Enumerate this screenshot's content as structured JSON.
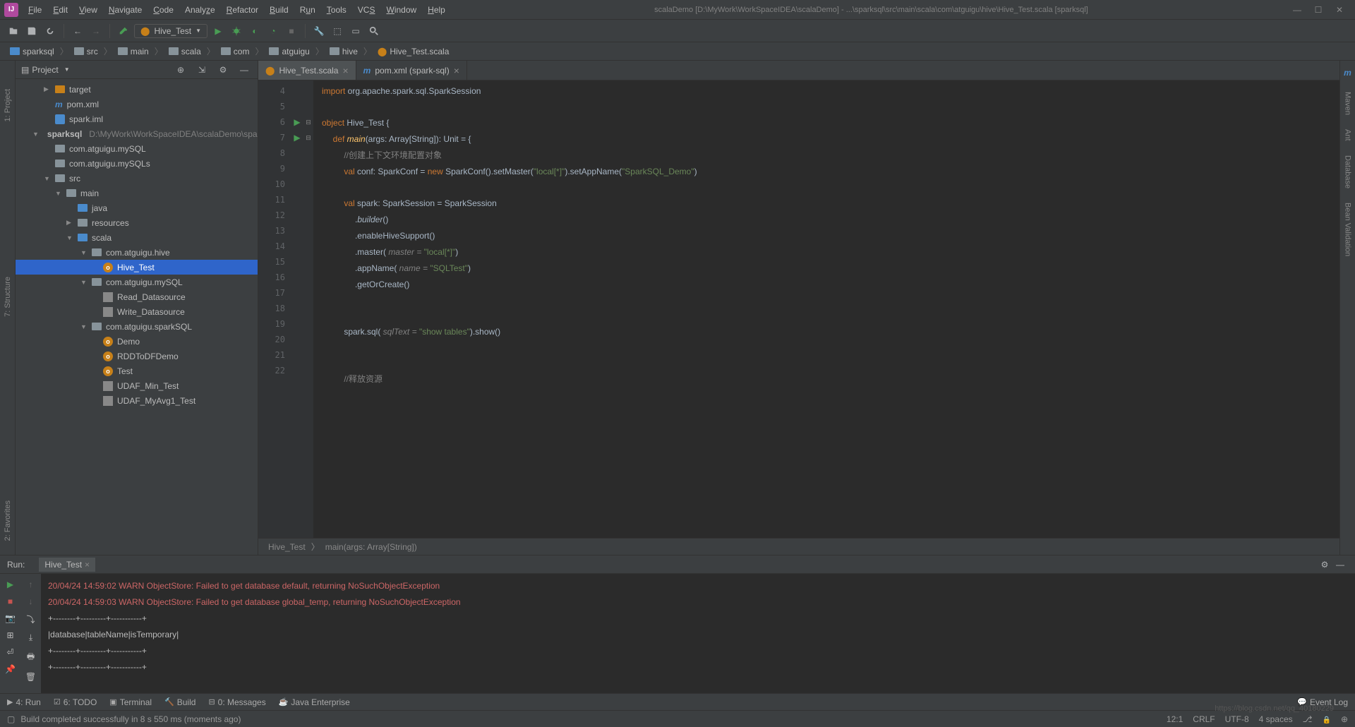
{
  "menu": {
    "items": [
      "File",
      "Edit",
      "View",
      "Navigate",
      "Code",
      "Analyze",
      "Refactor",
      "Build",
      "Run",
      "Tools",
      "VCS",
      "Window",
      "Help"
    ]
  },
  "title": "scalaDemo [D:\\MyWork\\WorkSpaceIDEA\\scalaDemo] - ...\\sparksql\\src\\main\\scala\\com\\atguigu\\hive\\Hive_Test.scala [sparksql]",
  "run_config": "Hive_Test",
  "breadcrumbs": [
    "sparksql",
    "src",
    "main",
    "scala",
    "com",
    "atguigu",
    "hive",
    "Hive_Test.scala"
  ],
  "project_panel": {
    "title": "Project"
  },
  "tree": {
    "target": "target",
    "pom": "pom.xml",
    "sparkiml": "spark.iml",
    "sparksql": "sparksql",
    "sparksql_path": "D:\\MyWork\\WorkSpaceIDEA\\scalaDemo\\spa",
    "pkg_mysql": "com.atguigu.mySQL",
    "pkg_mysqls": "com.atguigu.mySQLs",
    "src": "src",
    "main": "main",
    "java": "java",
    "resources": "resources",
    "scala": "scala",
    "pkg_hive": "com.atguigu.hive",
    "hive_test": "Hive_Test",
    "pkg_mysql2": "com.atguigu.mySQL",
    "read_ds": "Read_Datasource",
    "write_ds": "Write_Datasource",
    "pkg_sparksql": "com.atguigu.sparkSQL",
    "demo": "Demo",
    "rdd": "RDDToDFDemo",
    "test": "Test",
    "udaf_min": "UDAF_Min_Test",
    "udaf_avg": "UDAF_MyAvg1_Test"
  },
  "tabs": {
    "t1": "Hive_Test.scala",
    "t2": "pom.xml (spark-sql)"
  },
  "code": {
    "lines": [
      4,
      5,
      6,
      7,
      8,
      9,
      10,
      11,
      12,
      13,
      14,
      15,
      16,
      17,
      18,
      19,
      20,
      21,
      22
    ],
    "l4_a": "import",
    "l4_b": " org.apache.spark.sql.SparkSession",
    "l6_a": "object",
    "l6_b": " Hive_Test {",
    "l7_a": "def ",
    "l7_b": "main",
    "l7_c": "(args: Array[",
    "l7_d": "String",
    "l7_e": "]): Unit = {",
    "l8": "//创建上下文环境配置对象",
    "l9_a": "val",
    "l9_b": " conf: SparkConf = ",
    "l9_c": "new",
    "l9_d": " SparkConf().setMaster(",
    "l9_e": "\"local[*]\"",
    "l9_f": ").setAppName(",
    "l9_g": "\"SparkSQL_Demo\"",
    "l9_h": ")",
    "l11_a": "val",
    "l11_b": " spark: SparkSession = SparkSession",
    "l12_a": ".",
    "l12_b": "builder",
    "l12_c": "()",
    "l13": ".enableHiveSupport()",
    "l14_a": ".master( ",
    "l14_b": "master = ",
    "l14_c": "\"local[*]\"",
    "l14_d": ")",
    "l15_a": ".appName( ",
    "l15_b": "name = ",
    "l15_c": "\"SQLTest\"",
    "l15_d": ")",
    "l16": ".getOrCreate()",
    "l19_a": "spark.sql( ",
    "l19_b": "sqlText = ",
    "l19_c": "\"show tables\"",
    "l19_d": ").show()",
    "l22": "//释放资源"
  },
  "editor_crumbs": {
    "a": "Hive_Test",
    "b": "main(args: Array[String])"
  },
  "run_tab": {
    "label": "Run:",
    "name": "Hive_Test"
  },
  "console": {
    "l1": "20/04/24 14:59:02 WARN ObjectStore: Failed to get database default, returning NoSuchObjectException",
    "l2": "20/04/24 14:59:03 WARN ObjectStore: Failed to get database global_temp, returning NoSuchObjectException",
    "l3": "+--------+---------+-----------+",
    "l4": "|database|tableName|isTemporary|",
    "l5": "+--------+---------+-----------+",
    "l6": "+--------+---------+-----------+"
  },
  "bottom": {
    "run": "4: Run",
    "todo": "6: TODO",
    "terminal": "Terminal",
    "build": "Build",
    "messages": "0: Messages",
    "javaee": "Java Enterprise",
    "eventlog": "Event Log"
  },
  "status": {
    "msg": "Build completed successfully in 8 s 550 ms (moments ago)",
    "pos": "12:1",
    "crlf": "CRLF",
    "enc": "UTF-8",
    "indent": "4 spaces"
  },
  "right_rail": {
    "maven": "Maven",
    "ant": "Ant",
    "db": "Database",
    "bean": "Bean Validation"
  },
  "left_rail": {
    "proj": "1: Project",
    "struct": "7: Structure",
    "fav": "2: Favorites"
  },
  "watermark": "https://blog.csdn.net/qq_40180229"
}
